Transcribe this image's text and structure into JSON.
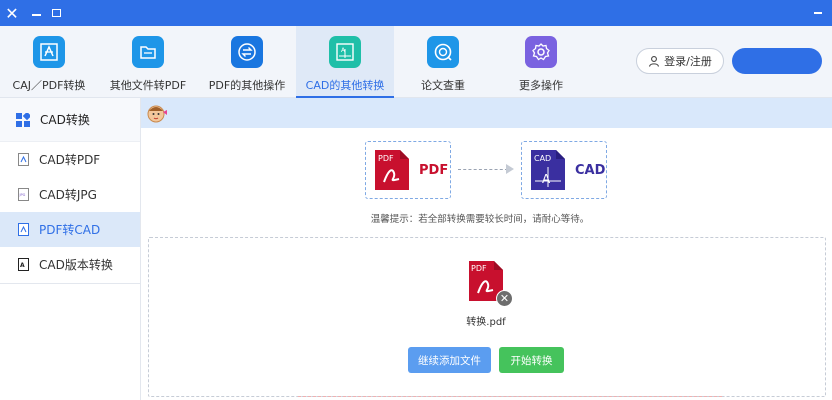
{
  "titlebar": {
    "accent": "#2f6fe6"
  },
  "toolbar": {
    "tools": [
      {
        "label": "CAJ／PDF转换",
        "icon": "caj-pdf-icon",
        "color": "#1e96e8"
      },
      {
        "label": "其他文件转PDF",
        "icon": "folder-icon",
        "color": "#1e96e8"
      },
      {
        "label": "PDF的其他操作",
        "icon": "swap-icon",
        "color": "#1976e0"
      },
      {
        "label": "CAD的其他转换",
        "icon": "cad-icon",
        "color": "#1fbfa8"
      },
      {
        "label": "论文查重",
        "icon": "check-icon",
        "color": "#1e96e8"
      },
      {
        "label": "更多操作",
        "icon": "gear-icon",
        "color": "#7a62e0"
      }
    ],
    "active_index": 3,
    "login_label": "登录/注册"
  },
  "sidebar": {
    "header": "CAD转换",
    "items": [
      {
        "label": "CAD转PDF",
        "icon": "pdf-file-icon"
      },
      {
        "label": "CAD转JPG",
        "icon": "jpg-file-icon"
      },
      {
        "label": "PDF转CAD",
        "icon": "pdf-file-icon"
      },
      {
        "label": "CAD版本转换",
        "icon": "cad-version-icon"
      }
    ],
    "active_index": 2
  },
  "conversion": {
    "from_badge": "PDF",
    "from_label": "PDF",
    "to_badge": "CAD",
    "to_label": "CAD",
    "from_color": "#c8102e",
    "to_color": "#3a2fa0"
  },
  "tip": "温馨提示：若全部转换需要较长时间，请耐心等待。",
  "file": {
    "badge": "PDF",
    "name": "转换.pdf"
  },
  "buttons": {
    "add": "继续添加文件",
    "start": "开始转换"
  }
}
